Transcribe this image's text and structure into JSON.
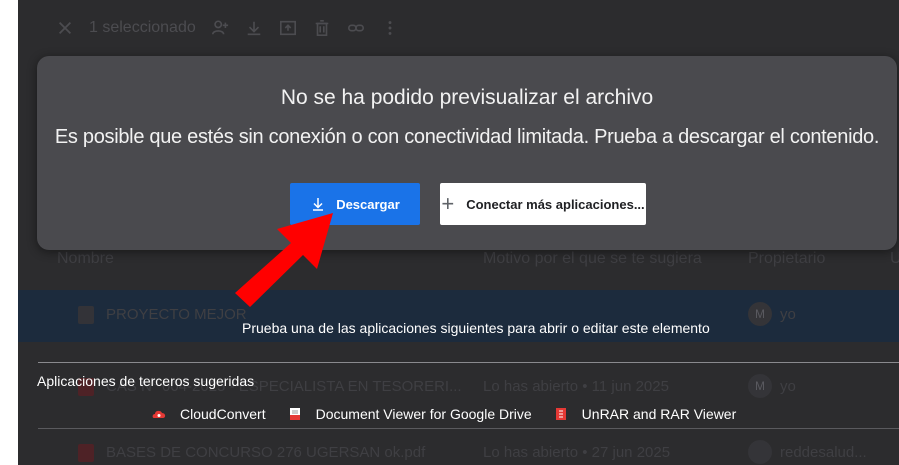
{
  "toolbar": {
    "selection_text": "1 seleccionado",
    "icons": [
      "close-icon",
      "share-person-icon",
      "download-icon",
      "move-to-folder-icon",
      "delete-icon",
      "link-icon",
      "more-vert-icon"
    ]
  },
  "table": {
    "headers": {
      "name": "Nombre",
      "reason": "Motivo por el que se te sugiera",
      "owner": "Propietario",
      "extra": "U"
    },
    "rows": [
      {
        "name": "PROYECTO MEJOR",
        "reason": "",
        "owner_initial": "M",
        "owner": "yo"
      },
      {
        "name": "CAS N° 004-2025 - ESPECIALISTA EN TESORERI...",
        "reason": "Lo has abierto • 11 jun 2025",
        "owner_initial": "M",
        "owner": "yo"
      },
      {
        "name": "BASES DE CONCURSO 276 UGERSAN ok.pdf",
        "reason": "Lo has abierto • 27 jun 2025",
        "owner_initial": "",
        "owner": "reddesalud..."
      }
    ]
  },
  "dialog": {
    "title": "No se ha podido previsualizar el archivo",
    "message": "Es posible que estés sin conexión o con conectividad limitada. Prueba a descargar el contenido.",
    "download_button": "Descargar",
    "connect_button": "Conectar más aplicaciones...",
    "connect_plus": "+"
  },
  "apps_panel": {
    "hint": "Prueba una de las aplicaciones siguientes para abrir o editar este elemento",
    "suggested_label": "Aplicaciones de terceros sugeridas",
    "apps": [
      {
        "label": "CloudConvert",
        "icon": "cloudconvert-icon",
        "color": "#e53935"
      },
      {
        "label": "Document Viewer for Google Drive",
        "icon": "document-viewer-icon",
        "color": "#e53935"
      },
      {
        "label": "UnRAR and RAR Viewer",
        "icon": "unrar-icon",
        "color": "#e53935"
      }
    ]
  },
  "colors": {
    "primary_button": "#1a73e8",
    "dialog_bg": "#4a4a4e",
    "annotation_arrow": "#ff0000",
    "selected_row": "#1c2b3d"
  }
}
